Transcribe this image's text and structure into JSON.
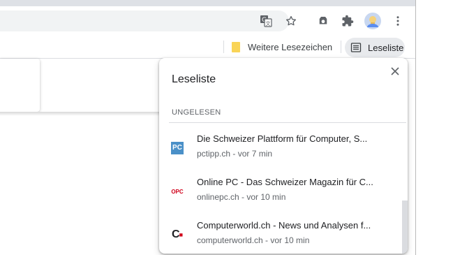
{
  "toolbar": {
    "icons": [
      "translate-icon",
      "star-icon",
      "extension-cloud-icon",
      "puzzle-icon",
      "avatar",
      "menu-dots-icon"
    ]
  },
  "bookmarks_bar": {
    "other_bookmarks_label": "Weitere Lesezeichen",
    "reading_list_label": "Leseliste"
  },
  "reading_list": {
    "title": "Leseliste",
    "section_unread": "UNGELESEN",
    "items": [
      {
        "title": "Die Schweizer Plattform für Computer, S...",
        "subtitle": "pctipp.ch - vor 7 min",
        "favicon": "pctipp-icon",
        "favicon_text": "PC"
      },
      {
        "title": "Online PC - Das Schweizer Magazin für C...",
        "subtitle": "onlinepc.ch - vor 10 min",
        "favicon": "onlinepc-icon",
        "favicon_text": "OPC"
      },
      {
        "title": "Computerworld.ch - News und Analysen f...",
        "subtitle": "computerworld.ch - vor 10 min",
        "favicon": "computerworld-icon",
        "favicon_text": "C"
      }
    ]
  },
  "colors": {
    "chrome_frame": "#dee1e6",
    "omnibox": "#f1f3f4",
    "reading_list_button": "#e8eaed",
    "pctipp_blue": "#4a90c8",
    "onlinepc_red": "#d0021b",
    "folder_yellow": "#f9d457"
  }
}
